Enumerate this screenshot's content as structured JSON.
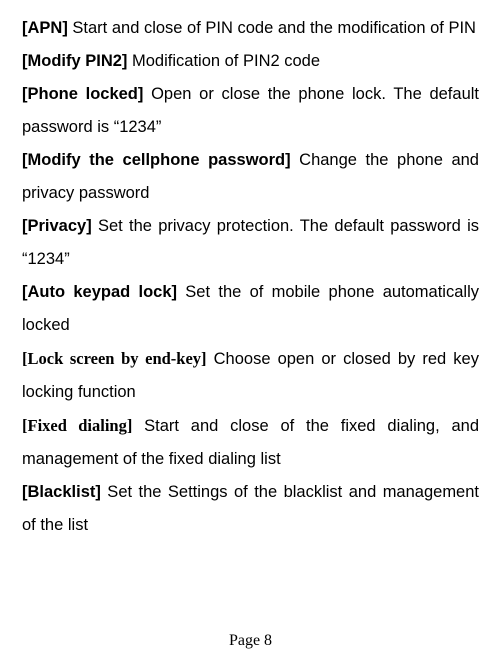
{
  "entries": [
    {
      "label": "[APN]",
      "labelClass": "label",
      "text": " Start and close of PIN code and the modification of PIN"
    },
    {
      "label": "[Modify PIN2]",
      "labelClass": "label",
      "text": " Modification of PIN2 code"
    },
    {
      "label": "[Phone locked]",
      "labelClass": "label",
      "text": " Open or close the phone lock. The default password is “1234”"
    },
    {
      "label": "[Modify the cellphone password]",
      "labelClass": "label",
      "text": " Change the phone and privacy password"
    },
    {
      "label": "[Privacy]",
      "labelClass": "label",
      "text": " Set the privacy protection. The default password is “1234”"
    },
    {
      "label": "[Auto keypad lock]",
      "labelClass": "label",
      "text": " Set the of mobile phone automatically locked"
    },
    {
      "label": "[Lock screen by end-key]",
      "labelClass": "serif",
      "text": " Choose open or closed by red key locking function"
    },
    {
      "label": "[Fixed dialing]",
      "labelClass": "serif",
      "text": " Start and close of the fixed dialing, and management of the fixed dialing list"
    },
    {
      "label": "[Blacklist]",
      "labelClass": "label",
      "text": " Set the Settings of the blacklist and management of the list"
    }
  ],
  "footer": "Page 8"
}
